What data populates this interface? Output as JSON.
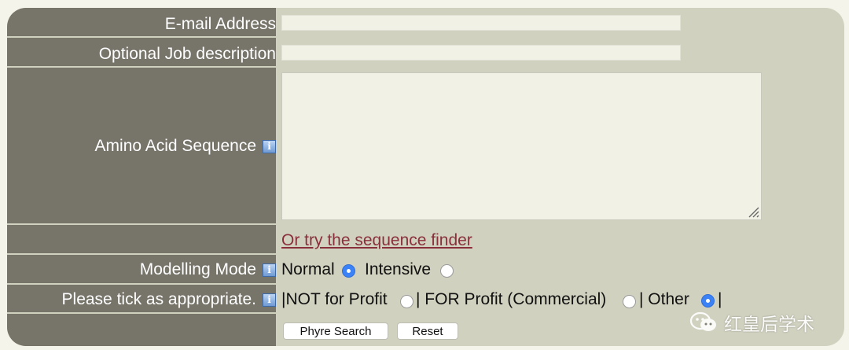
{
  "form": {
    "email": {
      "label": "E-mail Address",
      "value": ""
    },
    "job_description": {
      "label": "Optional Job description",
      "value": ""
    },
    "sequence": {
      "label": "Amino Acid Sequence",
      "value": ""
    },
    "sequence_finder_link": "Or try the sequence finder",
    "modelling_mode": {
      "label": "Modelling Mode",
      "options": [
        {
          "label": "Normal",
          "checked": true
        },
        {
          "label": "Intensive",
          "checked": false
        }
      ]
    },
    "usage": {
      "label": "Please tick as appropriate.",
      "options": [
        {
          "label": "|NOT for Profit",
          "checked": false
        },
        {
          "label": "| FOR Profit (Commercial)",
          "checked": false
        },
        {
          "label": "| Other",
          "checked": true
        }
      ],
      "trailing": "|"
    },
    "buttons": {
      "submit": "Phyre Search",
      "reset": "Reset"
    }
  },
  "icons": {
    "info": "info-icon",
    "info_glyph": "i"
  },
  "watermark": {
    "text": "红皇后学术",
    "icon": "wechat-icon"
  },
  "colors": {
    "label_background": "#77746a",
    "panel_background": "#d1d1c0",
    "link": "#8a2f3c",
    "radio_checked": "#3a82f6"
  }
}
